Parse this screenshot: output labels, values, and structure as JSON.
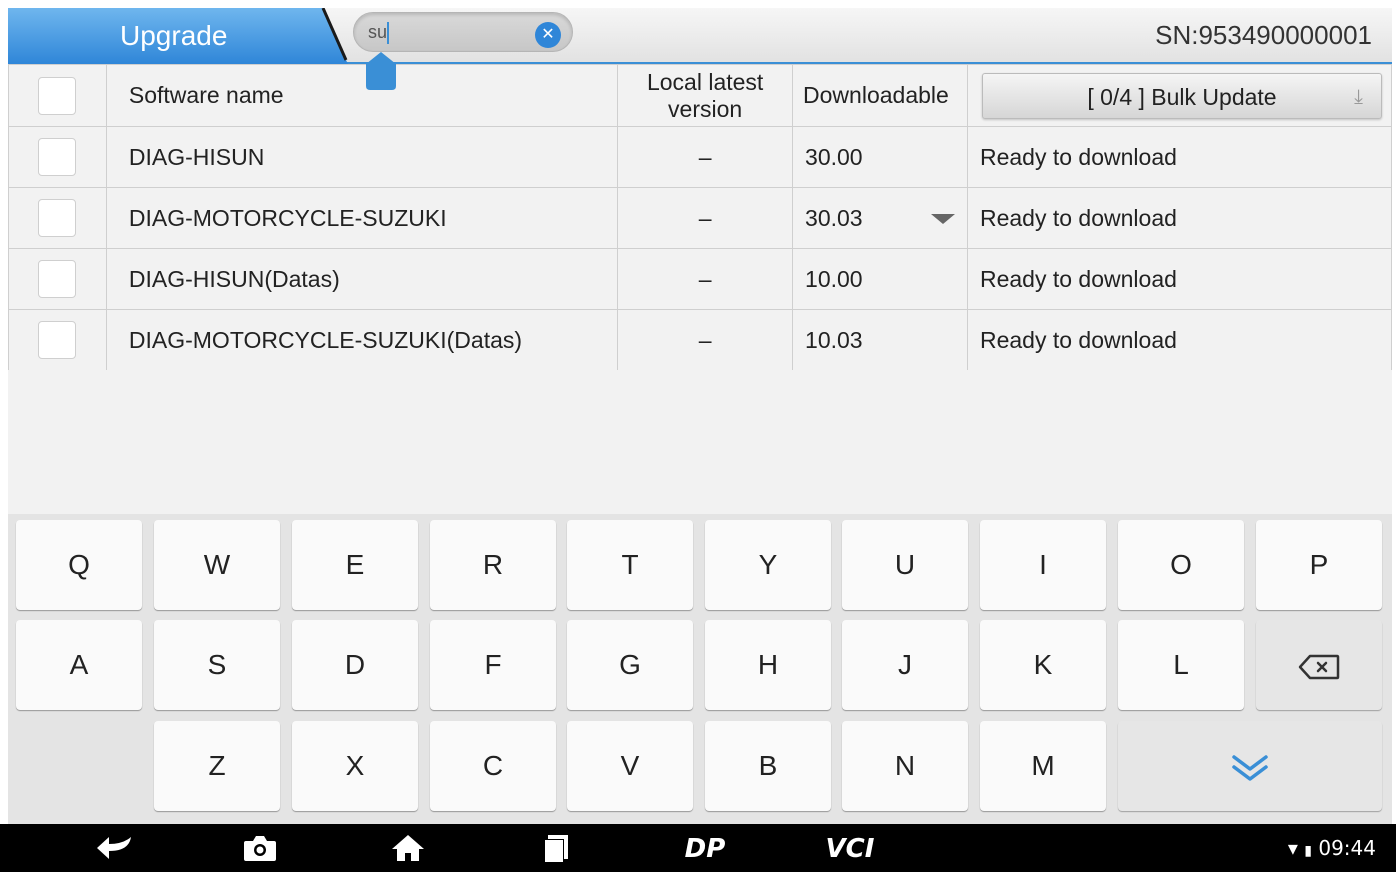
{
  "header": {
    "tab_label": "Upgrade",
    "search_value": "su",
    "serial": "SN:953490000001",
    "accent_color": "#3a8fd6"
  },
  "table": {
    "columns": {
      "name": "Software name",
      "local": "Local latest version",
      "downloadable": "Downloadable",
      "bulk_update": "[ 0/4 ] Bulk Update"
    },
    "rows": [
      {
        "name": "DIAG-HISUN",
        "local": "–",
        "downloadable": "30.00",
        "status": "Ready to download"
      },
      {
        "name": "DIAG-MOTORCYCLE-SUZUKI",
        "local": "–",
        "downloadable": "30.03",
        "status": "Ready to download"
      },
      {
        "name": "DIAG-HISUN(Datas)",
        "local": "–",
        "downloadable": "10.00",
        "status": "Ready to download"
      },
      {
        "name": "DIAG-MOTORCYCLE-SUZUKI(Datas)",
        "local": "–",
        "downloadable": "10.03",
        "status": "Ready to download"
      }
    ]
  },
  "keyboard": {
    "row1": [
      "Q",
      "W",
      "E",
      "R",
      "T",
      "Y",
      "U",
      "I",
      "O",
      "P"
    ],
    "row2": [
      "A",
      "S",
      "D",
      "F",
      "G",
      "H",
      "J",
      "K",
      "L"
    ],
    "row3": [
      "Z",
      "X",
      "C",
      "V",
      "B",
      "N",
      "M"
    ]
  },
  "navbar": {
    "icons": [
      "back-icon",
      "camera-icon",
      "home-icon",
      "recent-apps-icon",
      "dp-logo",
      "vci-logo"
    ],
    "dp_label": "DP",
    "vci_label": "VCI",
    "time": "09:44"
  }
}
